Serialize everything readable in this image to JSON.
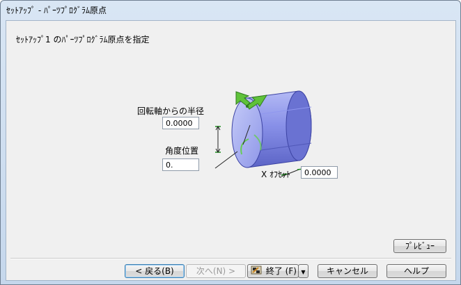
{
  "window": {
    "title": "ｾｯﾄｱｯﾌﾟ - ﾊﾟｰﾂﾌﾟﾛｸﾞﾗﾑ原点"
  },
  "main": {
    "heading": "ｾｯﾄｱｯﾌﾟ1 のﾊﾟｰﾂﾌﾟﾛｸﾞﾗﾑ原点を指定",
    "radius_label": "回転軸からの半径",
    "radius_value": "0.0000",
    "angle_label": "角度位置",
    "angle_value": "0.",
    "x_offset_label": "X ｵﾌｾｯﾄ",
    "x_offset_value": "0.0000"
  },
  "buttons": {
    "preview": "ﾌﾟﾚﾋﾞｭｰ",
    "back": "< 戻る(B)",
    "next": "次へ(N) >",
    "finish": "終了 (F)",
    "cancel": "キャンセル",
    "help": "ヘルプ"
  },
  "icons": {
    "finish": "flag-icon",
    "dropdown": "dropdown-arrow-icon",
    "move_gizmo": "move-arrows-icon"
  },
  "colors": {
    "cylinder": "#8890e8",
    "gizmo_green": "#5fc23a",
    "title_bar": "#d9e6f4"
  }
}
